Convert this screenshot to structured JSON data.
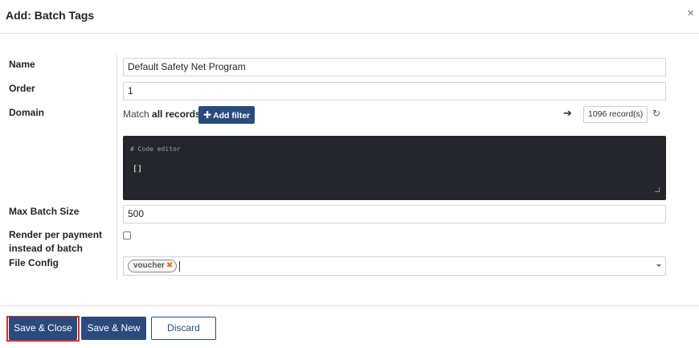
{
  "dialog": {
    "title": "Add: Batch Tags",
    "close_glyph": "×"
  },
  "form": {
    "name": {
      "label": "Name",
      "value": "Default Safety Net Program"
    },
    "order": {
      "label": "Order",
      "value": "1"
    },
    "domain": {
      "label": "Domain",
      "match_prefix": "Match",
      "match_bold": "all records",
      "add_filter_label": "Add filter",
      "arrow_glyph": "➔",
      "records_count": "1096 record(s)",
      "refresh_glyph": "↻",
      "code_editor_comment": "# Code editor",
      "code_value": "[]"
    },
    "max_batch_size": {
      "label": "Max Batch Size",
      "value": "500"
    },
    "render_per_payment": {
      "label_line1": "Render per payment",
      "label_line2": "instead of batch",
      "checked": false
    },
    "file_config": {
      "label": "File Config",
      "tags": [
        "voucher"
      ],
      "tag_remove_glyph": "✖"
    }
  },
  "footer": {
    "save_close_label": "Save & Close",
    "save_new_label": "Save & New",
    "discard_label": "Discard"
  },
  "colors": {
    "primary": "#2a4b7c",
    "focus_ring": "#d32f2f",
    "code_bg": "#23262b",
    "tag_remove": "#e07b1a"
  }
}
